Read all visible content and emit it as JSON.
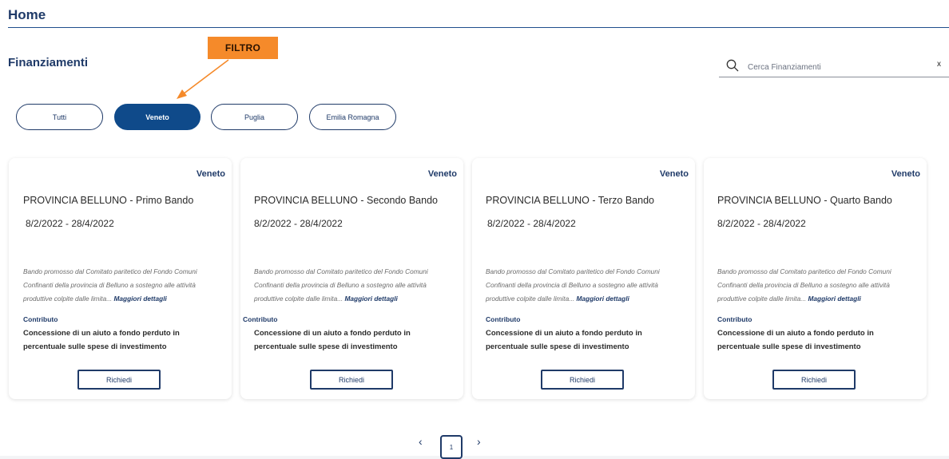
{
  "header": {
    "title": "Home"
  },
  "section": {
    "title": "Finanziamenti"
  },
  "callout": {
    "label": "FILTRO"
  },
  "search": {
    "placeholder": "Cerca Finanziamenti",
    "clear_label": "x"
  },
  "filters": [
    {
      "label": "Tutti",
      "active": false
    },
    {
      "label": "Veneto",
      "active": true
    },
    {
      "label": "Puglia",
      "active": false
    },
    {
      "label": "Emilia Romagna",
      "active": false
    }
  ],
  "cards": [
    {
      "region": "Veneto",
      "title": "PROVINCIA BELLUNO - Primo Bando",
      "dates": "8/2/2022 - 28/4/2022",
      "description": "Bando promosso dal Comitato paritetico del Fondo Comuni Confinanti della provincia di Belluno a sostegno alle attività produttive colpite dalle limita...",
      "more_link": "Maggiori dettagli",
      "type_label": "Contributo",
      "type_value": "Concessione di un aiuto a fondo perduto in percentuale sulle spese di investimento",
      "button": "Richiedi"
    },
    {
      "region": "Veneto",
      "title": "PROVINCIA BELLUNO - Secondo Bando",
      "dates": "8/2/2022 - 28/4/2022",
      "description": "Bando promosso dal Comitato paritetico del Fondo Comuni Confinanti della provincia di Belluno a sostegno alle attività produttive colpite dalle limita...",
      "more_link": "Maggiori dettagli",
      "type_label": "Contributo",
      "type_value": "Concessione di un aiuto a fondo perduto in percentuale sulle spese di investimento",
      "button": "Richiedi"
    },
    {
      "region": "Veneto",
      "title": "PROVINCIA BELLUNO - Terzo Bando",
      "dates": "8/2/2022 - 28/4/2022",
      "description": "Bando promosso dal Comitato paritetico del Fondo Comuni Confinanti della provincia di Belluno a sostegno alle attività produttive colpite dalle limita...",
      "more_link": "Maggiori dettagli",
      "type_label": "Contributo",
      "type_value": "Concessione di un aiuto a fondo perduto in percentuale sulle spese di investimento",
      "button": "Richiedi"
    },
    {
      "region": "Veneto",
      "title": "PROVINCIA BELLUNO - Quarto Bando",
      "dates": "8/2/2022 - 28/4/2022",
      "description": "Bando promosso dal Comitato paritetico del Fondo Comuni Confinanti della provincia di Belluno a sostegno alle attività produttive colpite dalle limita...",
      "more_link": "Maggiori dettagli",
      "type_label": "Contributo",
      "type_value": "Concessione di un aiuto a fondo perduto in percentuale sulle spese di investimento",
      "button": "Richiedi"
    }
  ],
  "pagination": {
    "prev": "‹",
    "current": "1",
    "next": "›"
  },
  "colors": {
    "primary": "#1f3a68",
    "active_pill": "#0f4a8a",
    "callout": "#f58a2a"
  }
}
